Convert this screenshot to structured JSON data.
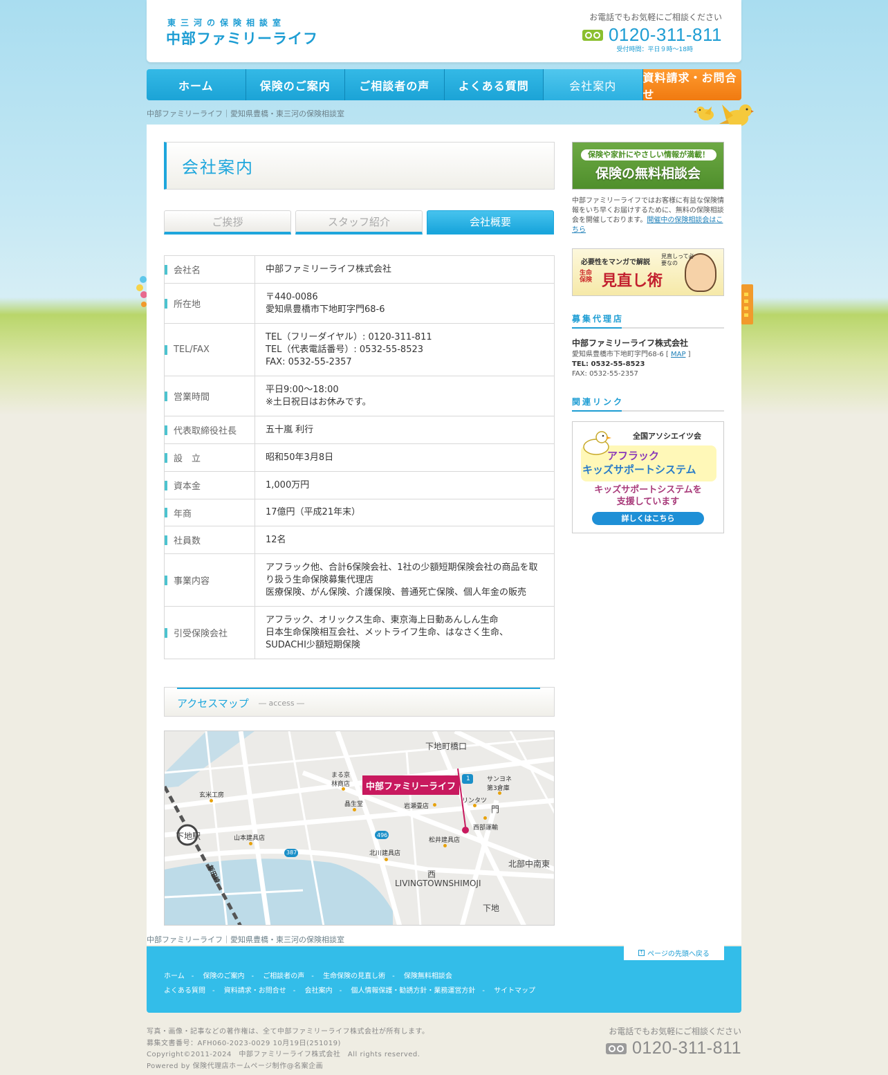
{
  "header": {
    "tagline": "東三河の保険相談室",
    "logo": "中部ファミリーライフ",
    "tel_lead": "お電話でもお気軽にご相談ください",
    "tel_number": "0120-311-811",
    "tel_hours": "受付時間：平日９時〜18時"
  },
  "nav": {
    "items": [
      {
        "label": "ホーム"
      },
      {
        "label": "保険のご案内"
      },
      {
        "label": "ご相談者の声"
      },
      {
        "label": "よくある質問"
      },
      {
        "label": "会社案内"
      },
      {
        "label": "資料請求・お問合せ"
      }
    ]
  },
  "breadcrumb": "中部ファミリーライフ｜愛知県豊橋・東三河の保険相談室",
  "main": {
    "page_title": "会社案内",
    "tabs": [
      {
        "label": "ご挨拶"
      },
      {
        "label": "スタッフ紹介"
      },
      {
        "label": "会社概要"
      }
    ],
    "table": [
      {
        "label": "会社名",
        "lines": [
          "中部ファミリーライフ株式会社"
        ]
      },
      {
        "label": "所在地",
        "lines": [
          "〒440-0086",
          "愛知県豊橋市下地町字門68-6"
        ]
      },
      {
        "label": "TEL/FAX",
        "lines": [
          "TEL（フリーダイヤル）: 0120-311-811",
          "TEL（代表電話番号）: 0532-55-8523",
          "FAX: 0532-55-2357"
        ]
      },
      {
        "label": "営業時間",
        "lines": [
          "平日9:00〜18:00",
          "※土日祝日はお休みです。"
        ]
      },
      {
        "label": "代表取締役社長",
        "lines": [
          "五十嵐 利行"
        ]
      },
      {
        "label": "設　立",
        "lines": [
          "昭和50年3月8日"
        ]
      },
      {
        "label": "資本金",
        "lines": [
          "1,000万円"
        ]
      },
      {
        "label": "年商",
        "lines": [
          "17億円（平成21年末）"
        ]
      },
      {
        "label": "社員数",
        "lines": [
          "12名"
        ]
      },
      {
        "label": "事業内容",
        "lines": [
          "アフラック他、合計6保険会社、1社の少額短期保険会社の商品を取り扱う生命保険募集代理店",
          "医療保険、がん保険、介護保険、普通死亡保険、個人年金の販売"
        ]
      },
      {
        "label": "引受保険会社",
        "lines": [
          "アフラック、オリックス生命、東京海上日動あんしん生命",
          "日本生命保険相互会社、メットライフ生命、はなさく生命、SUDACHI少額短期保険"
        ]
      }
    ],
    "access_title": "アクセスマップ",
    "access_sub": "― access ―",
    "map": {
      "pin_label": "中部ファミリーライフ",
      "labels": [
        "下地町橋口",
        "まる京林商店",
        "サンヨネ第3倉庫",
        "玄米工房",
        "晶生堂",
        "岩瀬畳店",
        "リンタツ",
        "門",
        "西部運輸",
        "下地駅",
        "山本建具店",
        "松井建具店",
        "北川建具店",
        "北部中南東",
        "西",
        "LIVINGTOWNSHIMOJI",
        "下地",
        "飯田線",
        "496",
        "387",
        "1"
      ]
    }
  },
  "sidebar": {
    "banner1_top": "保険や家計にやさしい情報が満載！",
    "banner1_main": "保険の無料相談会",
    "desc": "中部ファミリーライフではお客様に有益な保険情報をいち早くお届けするために、無料の保険相談会を開催しております。",
    "desc_link": "開催中の保険相談会はこちら",
    "banner2_top": "必要性をマンガで解説",
    "banner2_side": "生命保険",
    "banner2_main": "見直し術",
    "banner2_bubble": "見直しって必要なの",
    "agency_heading": "募集代理店",
    "agency_name": "中部ファミリーライフ株式会社",
    "agency_address": "愛知県豊橋市下地町字門68-6",
    "agency_map": "MAP",
    "agency_tel_label": "TEL: ",
    "agency_tel": "0532-55-8523",
    "agency_fax": "FAX: 0532-55-2357",
    "links_heading": "関連リンク",
    "kids_top": "全国アソシエイツ会",
    "kids_line1": "アフラック",
    "kids_line2": "キッズサポートシステム",
    "kids_line3": "キッズサポートシステムを",
    "kids_line4": "支援しています",
    "kids_button": "詳しくはこちら"
  },
  "footer": {
    "breadcrumb": "中部ファミリーライフ｜愛知県豊橋・東三河の保険相談室",
    "pagetop": "ページの先頭へ戻る",
    "links_row1": [
      "ホーム",
      "保険のご案内",
      "ご相談者の声",
      "生命保険の見直し術",
      "保険無料相談会"
    ],
    "links_row2": [
      "よくある質問",
      "資料請求・お問合せ",
      "会社案内",
      "個人情報保護・勧誘方針・業務運営方針",
      "サイトマップ"
    ],
    "copy_lines": [
      "写真・画像・記事などの著作権は、全て中部ファミリーライフ株式会社が所有します。",
      "募集文書番号：AFH060-2023-0029 10月19日(251019)",
      "Copyright©2011-2024　中部ファミリーライフ株式会社　All rights reserved.",
      "Powered by 保険代理店ホームページ制作@名案企画"
    ],
    "tel_lead": "お電話でもお気軽にご相談ください",
    "tel_number": "0120-311-811"
  },
  "colors": {
    "brand_blue": "#1d9dd3",
    "nav_blue": "#1ba3d6",
    "contact_orange": "#f07a10",
    "pin_magenta": "#c8195e",
    "footer_blue": "#33bde9"
  }
}
